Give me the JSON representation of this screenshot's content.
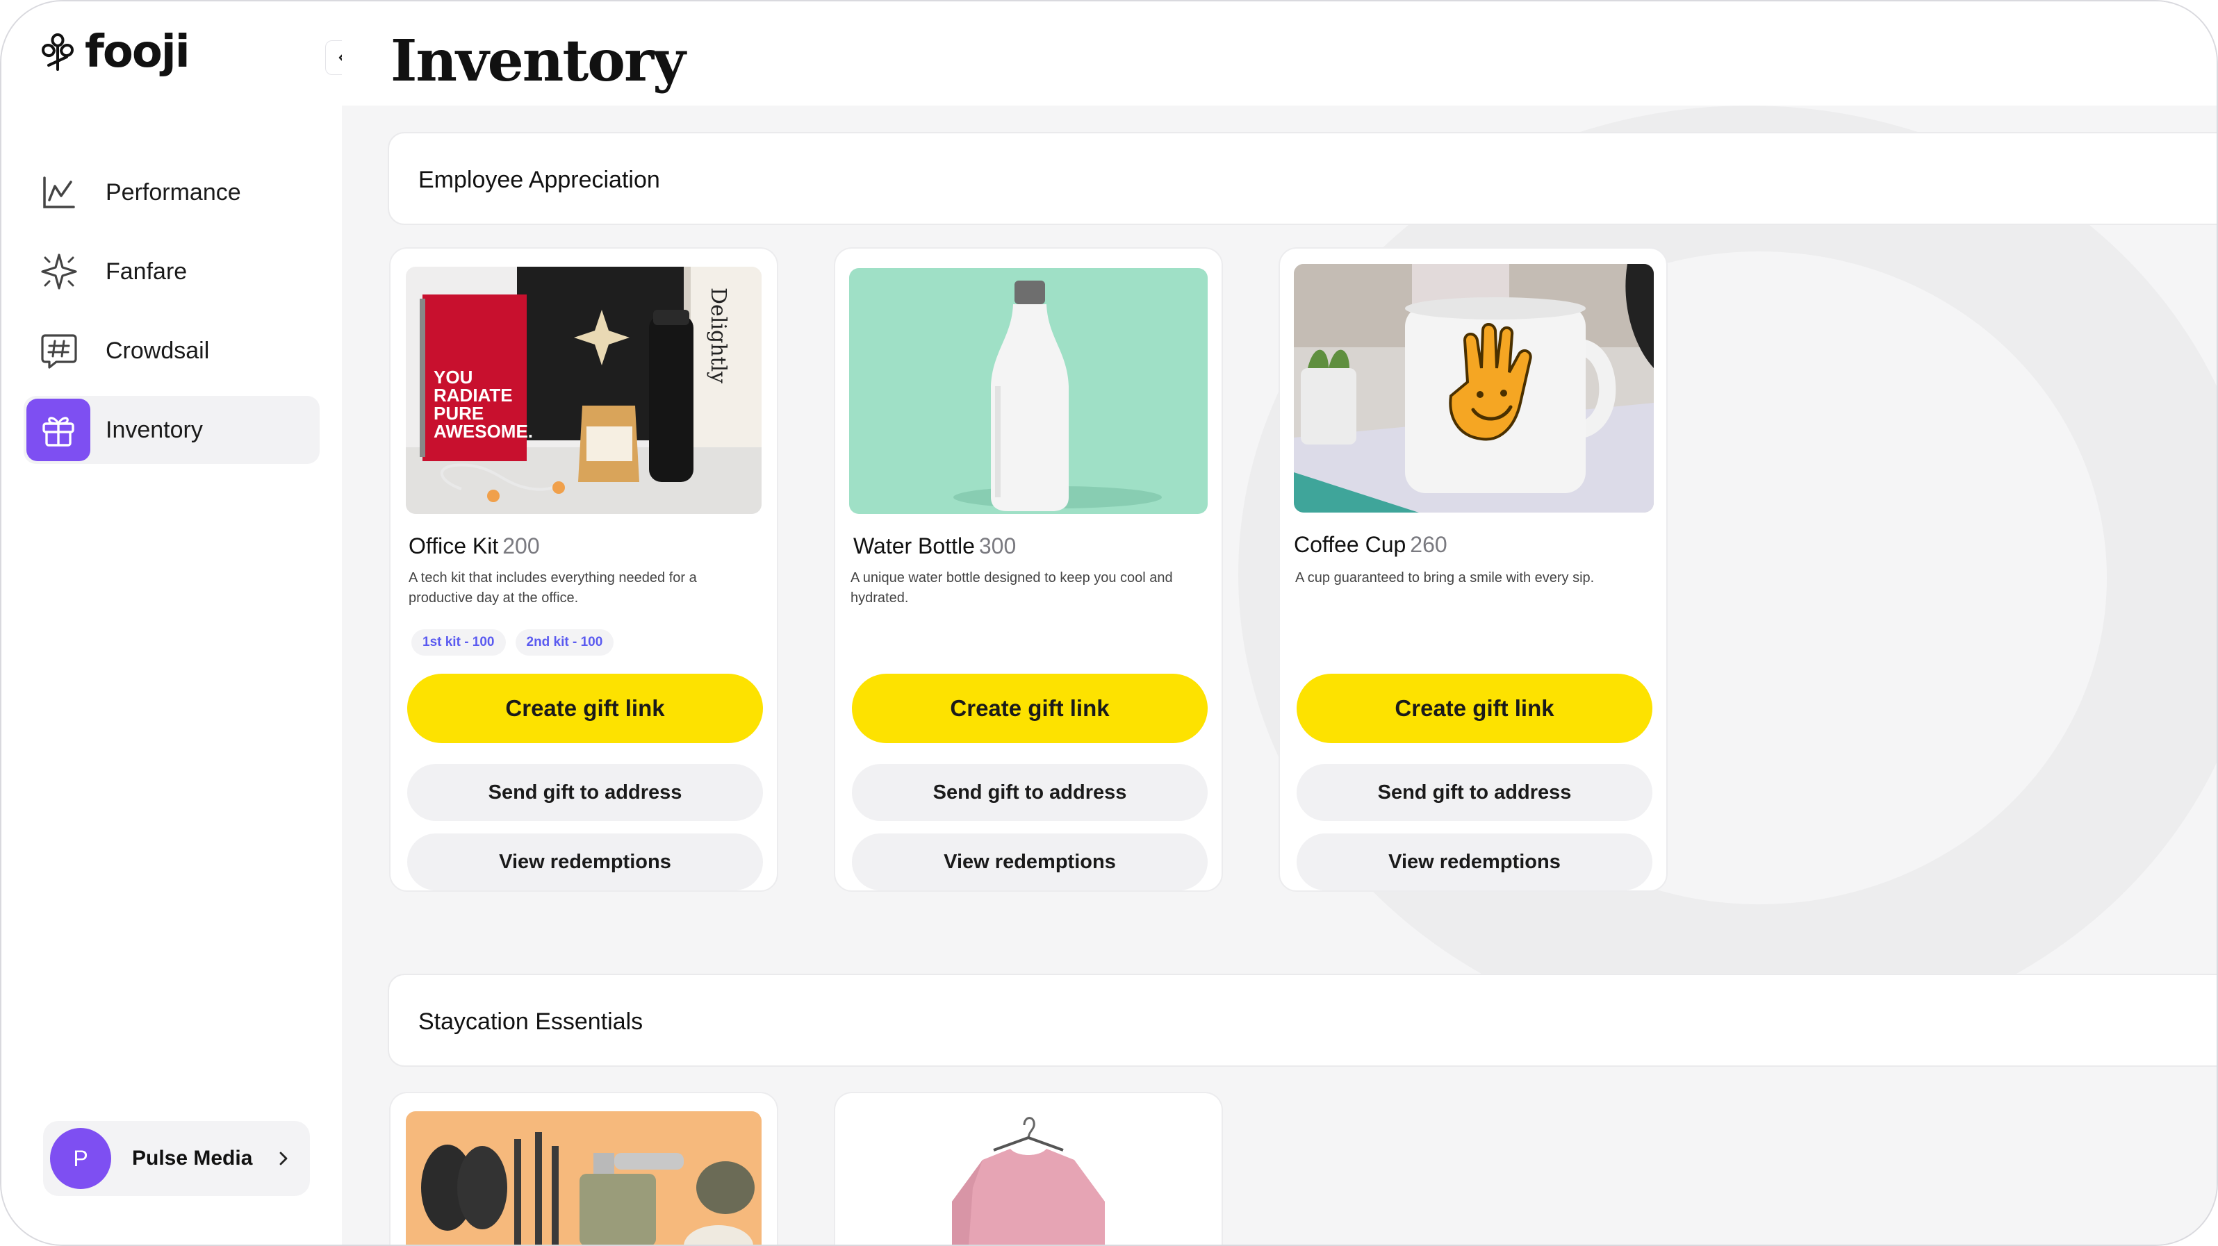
{
  "brand": {
    "name": "fooji",
    "accent": "#7e4ff2",
    "button_yellow": "#fde200"
  },
  "sidebar": {
    "collapse_icon": "chevron-left-icon",
    "items": [
      {
        "label": "Performance",
        "icon": "chart-line-icon",
        "active": false
      },
      {
        "label": "Fanfare",
        "icon": "sparkle-icon",
        "active": false
      },
      {
        "label": "Crowdsail",
        "icon": "hashtag-icon",
        "active": false
      },
      {
        "label": "Inventory",
        "icon": "gift-icon",
        "active": true
      }
    ],
    "account": {
      "initial": "P",
      "name": "Pulse Media"
    }
  },
  "page": {
    "title": "Inventory"
  },
  "sections": [
    {
      "title": "Employee Appreciation",
      "cards": [
        {
          "name": "Office Kit",
          "quantity": "200",
          "description": "A tech kit that includes everything needed for a productive day at the office.",
          "tags": [
            "1st kit - 100",
            "2nd kit - 100"
          ],
          "image_text": [
            "YOU",
            "RADIATE",
            "PURE",
            "AWESOME.",
            "Delightly"
          ],
          "primary": "Create gift link",
          "secondary": "Send gift to address",
          "tertiary": "View redemptions"
        },
        {
          "name": "Water Bottle",
          "quantity": "300",
          "description": "A unique water bottle designed to keep you cool and hydrated.",
          "primary": "Create gift link",
          "secondary": "Send gift to address",
          "tertiary": "View redemptions"
        },
        {
          "name": "Coffee Cup",
          "quantity": "260",
          "description": "A cup guaranteed to bring a smile with every sip.",
          "primary": "Create gift link",
          "secondary": "Send gift to address",
          "tertiary": "View redemptions"
        }
      ]
    },
    {
      "title": "Staycation Essentials",
      "cards": [
        {
          "image": "hiking-gear-flatlay"
        },
        {
          "image": "pink-sweater-on-hanger"
        }
      ]
    }
  ]
}
